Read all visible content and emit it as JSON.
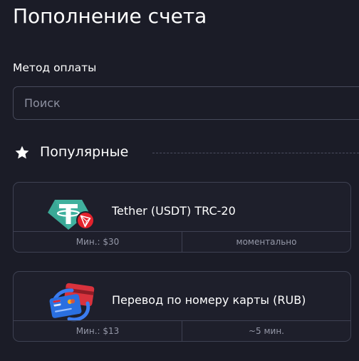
{
  "page": {
    "title": "Пополнение счета"
  },
  "payment_method": {
    "label": "Метод оплаты",
    "search_placeholder": "Поиск",
    "search_value": ""
  },
  "popular": {
    "title": "Популярные",
    "icon": "star-icon",
    "items": [
      {
        "name": "Tether (USDT) TRC-20",
        "icon": "tether-tron-icon",
        "min": "Мин.: $30",
        "speed": "моментально"
      },
      {
        "name": "Перевод по номеру карты (RUB)",
        "icon": "bank-cards-icon",
        "min": "Мин.: $13",
        "speed": "~5 мин."
      }
    ]
  },
  "colors": {
    "background": "#1b1c27",
    "card_background": "#1e1f2b",
    "border": "#3e4152",
    "muted_text": "#9598a8",
    "tether_green": "#3aa896",
    "tron_red": "#e3232d",
    "card_blue": "#2a6fe0",
    "card_red": "#d8323d"
  }
}
